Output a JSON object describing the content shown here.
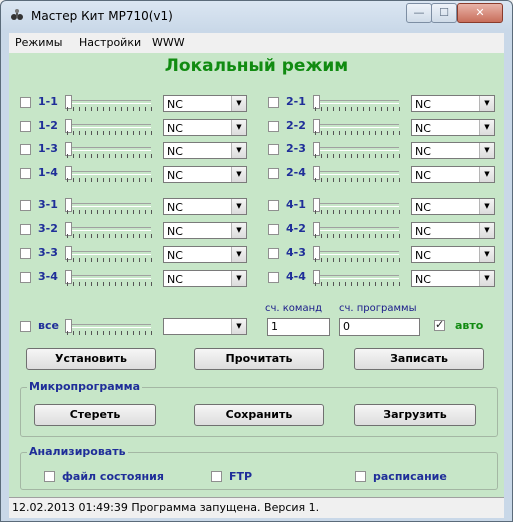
{
  "window": {
    "title": "Мастер Кит MP710(v1)"
  },
  "menu": [
    "Режимы",
    "Настройки",
    "WWW"
  ],
  "heading": "Локальный режим",
  "channels": [
    {
      "label": "1-1",
      "value": "NC",
      "checked": false
    },
    {
      "label": "1-2",
      "value": "NC",
      "checked": false
    },
    {
      "label": "1-3",
      "value": "NC",
      "checked": false
    },
    {
      "label": "1-4",
      "value": "NC",
      "checked": false
    },
    {
      "label": "2-1",
      "value": "NC",
      "checked": false
    },
    {
      "label": "2-2",
      "value": "NC",
      "checked": false
    },
    {
      "label": "2-3",
      "value": "NC",
      "checked": false
    },
    {
      "label": "2-4",
      "value": "NC",
      "checked": false
    },
    {
      "label": "3-1",
      "value": "NC",
      "checked": false
    },
    {
      "label": "3-2",
      "value": "NC",
      "checked": false
    },
    {
      "label": "3-3",
      "value": "NC",
      "checked": false
    },
    {
      "label": "3-4",
      "value": "NC",
      "checked": false
    },
    {
      "label": "4-1",
      "value": "NC",
      "checked": false
    },
    {
      "label": "4-2",
      "value": "NC",
      "checked": false
    },
    {
      "label": "4-3",
      "value": "NC",
      "checked": false
    },
    {
      "label": "4-4",
      "value": "NC",
      "checked": false
    }
  ],
  "all": {
    "label": "все",
    "value": "",
    "checked": false
  },
  "counters": {
    "commands_label": "сч. команд",
    "commands_value": "1",
    "program_label": "сч. программы",
    "program_value": "0"
  },
  "auto": {
    "label": "авто",
    "checked": true
  },
  "buttons": {
    "set": "Установить",
    "read": "Прочитать",
    "write": "Записать"
  },
  "microprogram": {
    "title": "Микропрограмма",
    "erase": "Стереть",
    "save": "Сохранить",
    "load": "Загрузить"
  },
  "analyze": {
    "title": "Анализировать",
    "options": [
      {
        "label": "файл состояния",
        "checked": false
      },
      {
        "label": "FTP",
        "checked": false
      },
      {
        "label": "расписание",
        "checked": false
      }
    ]
  },
  "status": "12.02.2013 01:49:39 Программа запущена. Версия 1.",
  "icons": {
    "app": "app-icon",
    "minimize": "minimize-icon",
    "maximize": "maximize-icon",
    "close": "close-icon",
    "dropdown": "chevron-down-icon"
  },
  "colors": {
    "client_bg": "#c7e6c8",
    "heading": "#118b11",
    "label": "#1f2e99"
  }
}
